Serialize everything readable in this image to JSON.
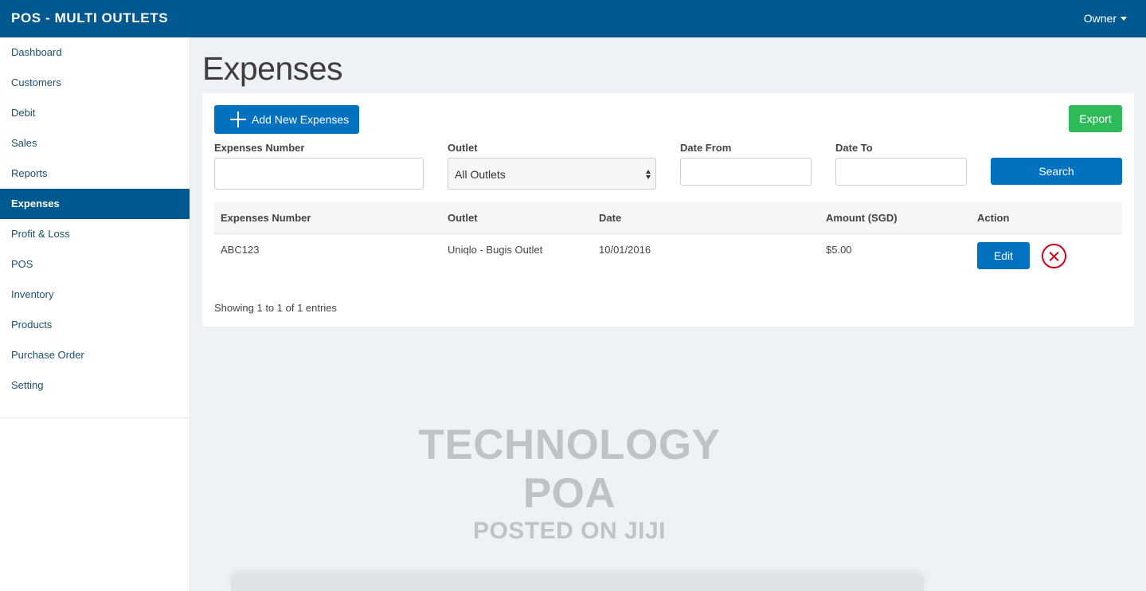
{
  "app": {
    "title": "POS - MULTI OUTLETS",
    "user_menu": "Owner"
  },
  "sidebar": {
    "items": [
      {
        "label": "Dashboard",
        "active": false
      },
      {
        "label": "Customers",
        "active": false
      },
      {
        "label": "Debit",
        "active": false
      },
      {
        "label": "Sales",
        "active": false
      },
      {
        "label": "Reports",
        "active": false
      },
      {
        "label": "Expenses",
        "active": true
      },
      {
        "label": "Profit & Loss",
        "active": false
      },
      {
        "label": "POS",
        "active": false
      },
      {
        "label": "Inventory",
        "active": false
      },
      {
        "label": "Products",
        "active": false
      },
      {
        "label": "Purchase Order",
        "active": false
      },
      {
        "label": "Setting",
        "active": false
      }
    ]
  },
  "page": {
    "title": "Expenses"
  },
  "toolbar": {
    "add_label": "Add New Expenses",
    "export_label": "Export"
  },
  "filters": {
    "expenses_number": {
      "label": "Expenses Number",
      "value": ""
    },
    "outlet": {
      "label": "Outlet",
      "value": "All Outlets"
    },
    "date_from": {
      "label": "Date From",
      "value": ""
    },
    "date_to": {
      "label": "Date To",
      "value": ""
    },
    "search_label": "Search"
  },
  "table": {
    "columns": [
      "Expenses Number",
      "Outlet",
      "Date",
      "Amount (SGD)",
      "Action"
    ],
    "rows": [
      {
        "number": "ABC123",
        "outlet": "Uniqlo - Bugis Outlet",
        "date": "10/01/2016",
        "amount": "$5.00",
        "edit_label": "Edit"
      }
    ]
  },
  "footer": {
    "entries_info": "Showing 1 to 1 of 1 entries"
  },
  "watermark": {
    "main": "TECHNOLOGY POA",
    "sub": "POSTED ON JIJI"
  },
  "colors": {
    "primary": "#02598f",
    "button_blue": "#0272c0",
    "export_green": "#2fbb5a",
    "delete_red": "#d0021b"
  }
}
